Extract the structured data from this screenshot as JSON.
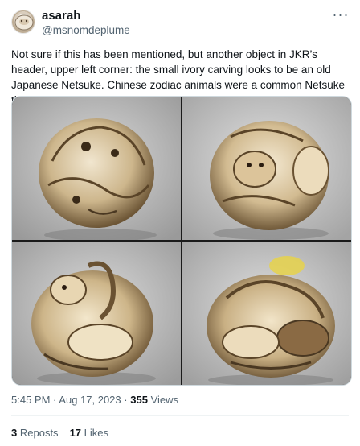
{
  "author": {
    "display_name": "asarah",
    "handle": "@msnomdeplume",
    "avatar_icon": "avatar-image"
  },
  "more_icon": "ellipsis-icon",
  "tweet": {
    "text": "Not sure if this has been mentioned, but another object in JKR’s  header, upper left corner: the small ivory carving looks to be an old Japanese Netsuke. Chinese zodiac animals were a common Netsuke theme."
  },
  "media": {
    "photos": [
      {
        "icon": "netsuke-carving-photo"
      },
      {
        "icon": "netsuke-carving-photo"
      },
      {
        "icon": "netsuke-carving-photo"
      },
      {
        "icon": "netsuke-carving-photo"
      }
    ]
  },
  "meta": {
    "time": "5:45 PM",
    "separator": "·",
    "date": "Aug 17, 2023",
    "views_count": "355",
    "views_label": "Views"
  },
  "stats": {
    "reposts_count": "3",
    "reposts_label": "Reposts",
    "likes_count": "17",
    "likes_label": "Likes"
  },
  "colors": {
    "text_primary": "#0f1419",
    "text_secondary": "#536471",
    "border": "#cfd9de"
  }
}
